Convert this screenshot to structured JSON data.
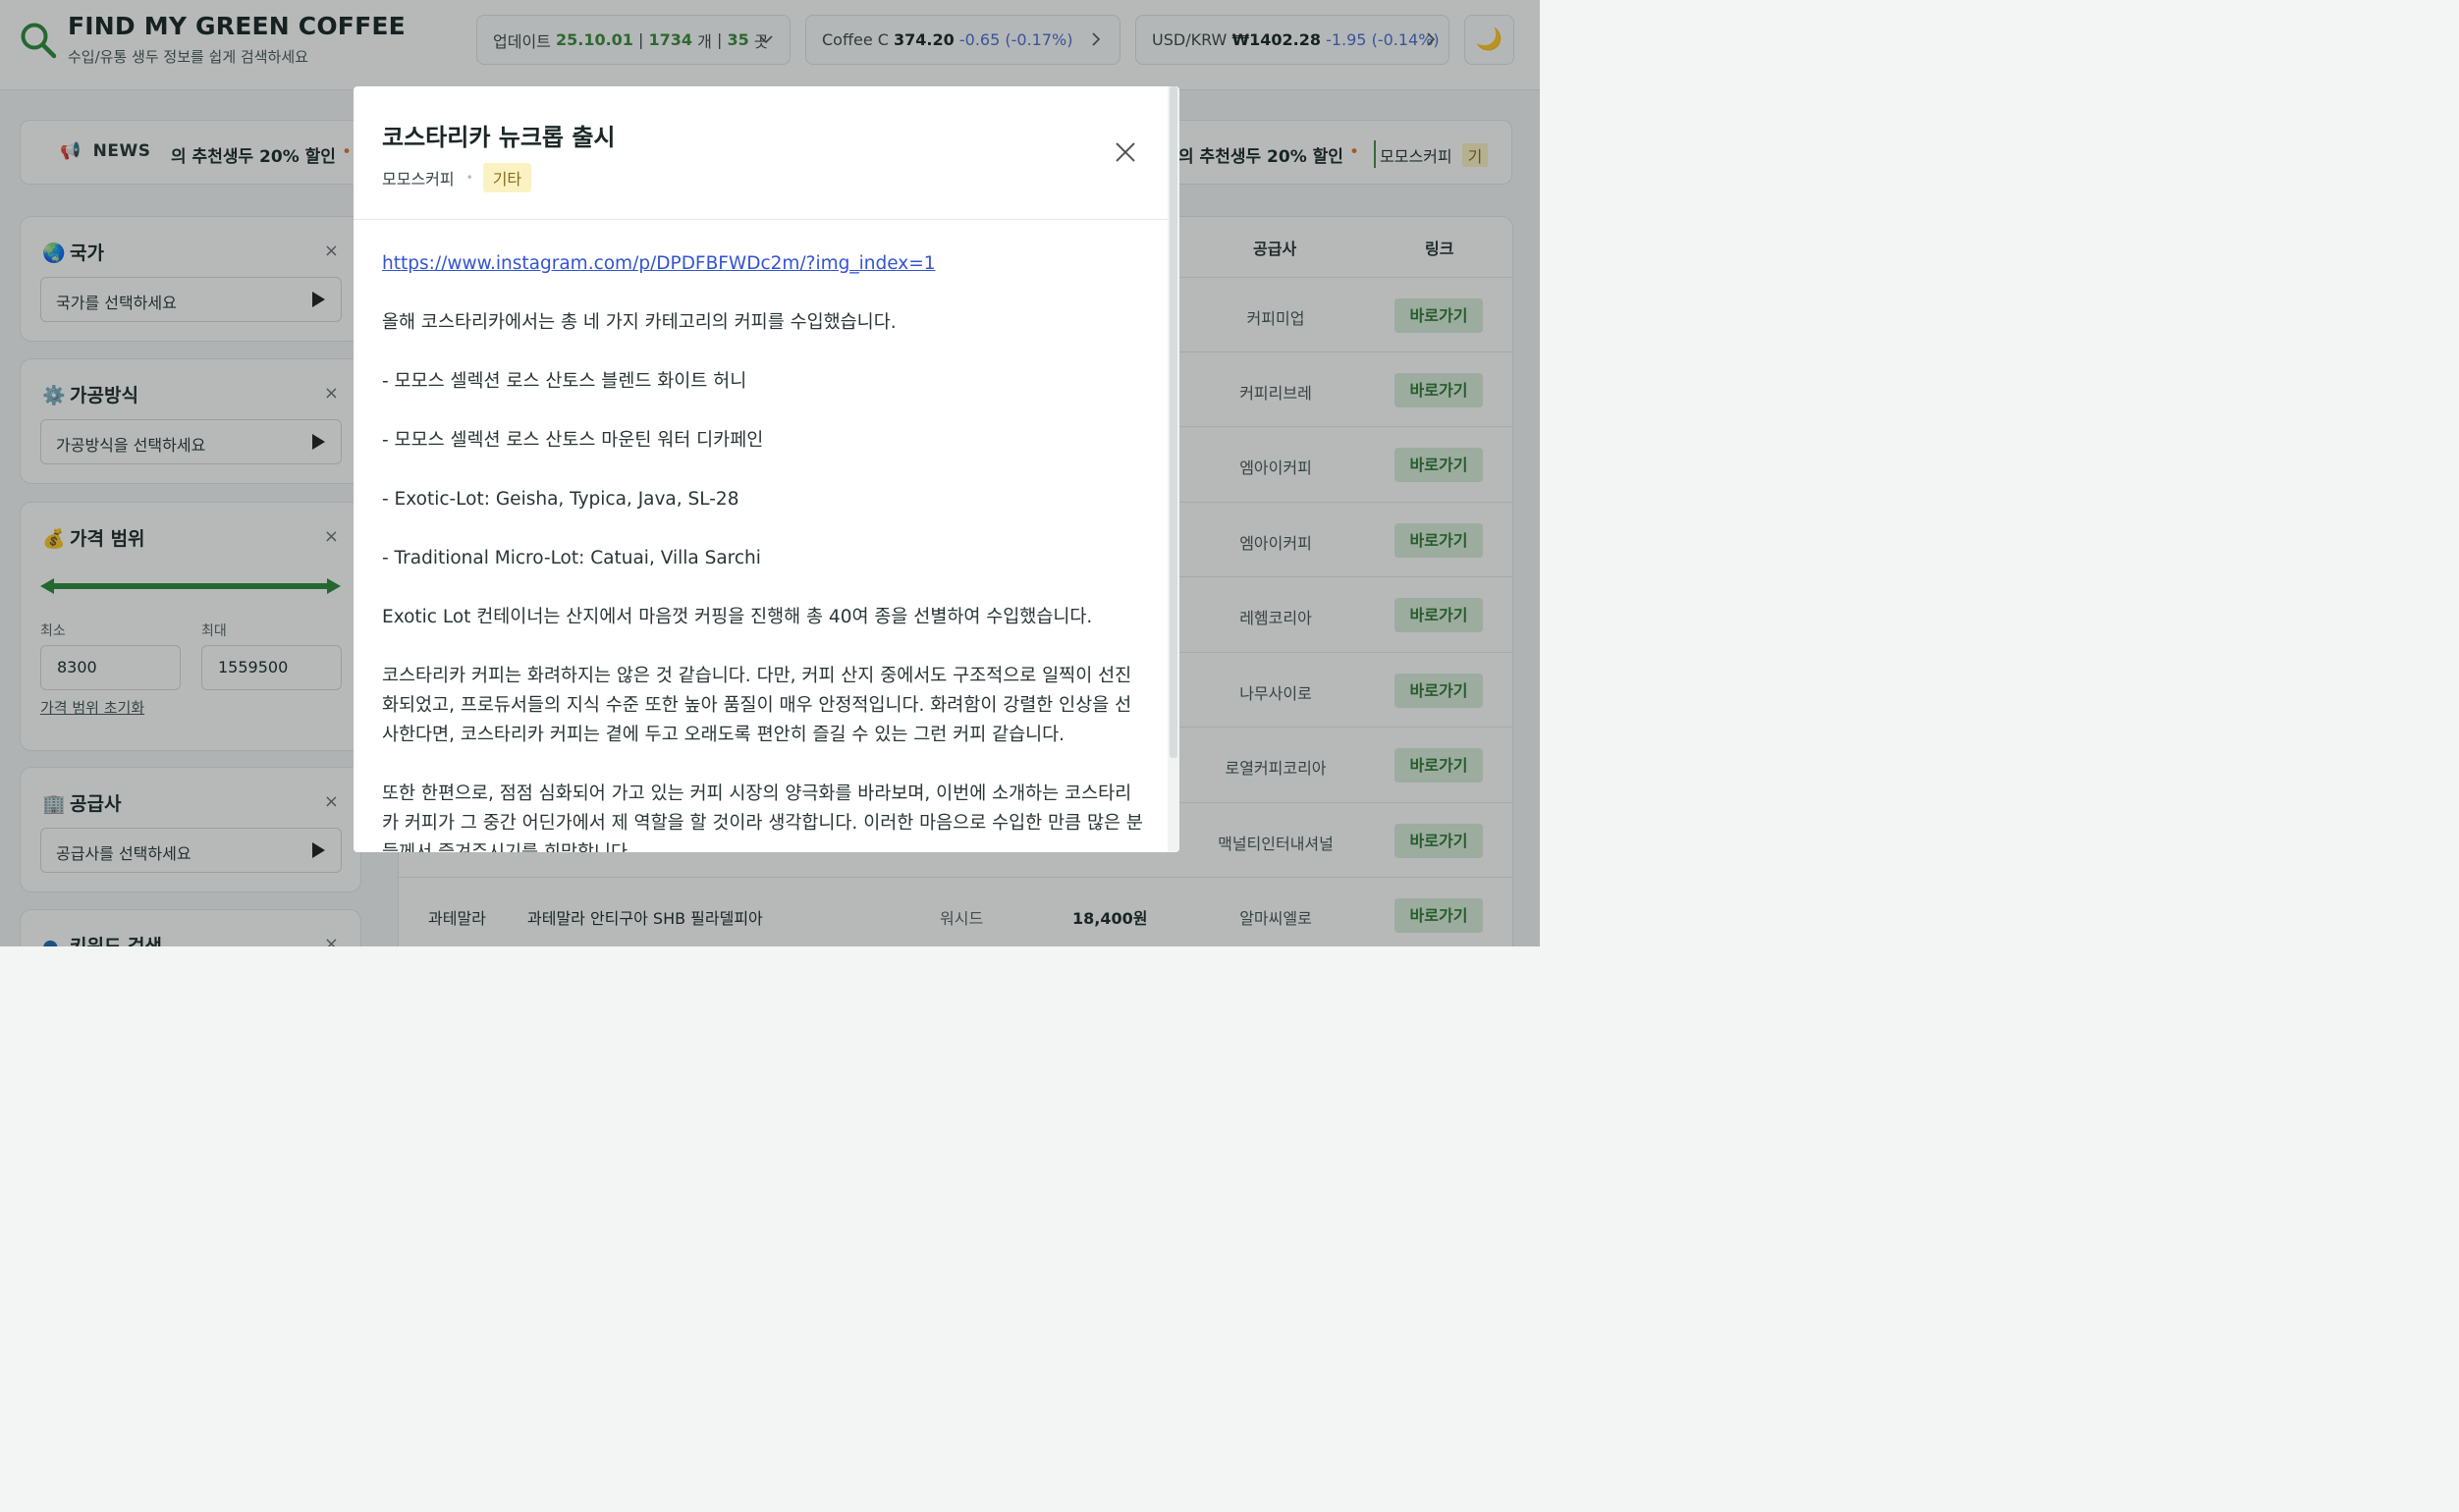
{
  "brand": {
    "title": "FIND MY GREEN COFFEE",
    "subtitle": "수입/유통 생두 정보를 쉽게 검색하세요"
  },
  "header": {
    "update": {
      "label": "업데이트",
      "date": "25.10.01",
      "sep1": "|",
      "count": "1734",
      "count_unit": "개",
      "sep2": "|",
      "suppliers": "35",
      "suppliers_unit": "곳"
    },
    "coffee_c": {
      "label": "Coffee C",
      "price": "374.20",
      "change": "-0.65",
      "pct": "(-0.17%)"
    },
    "usd_krw": {
      "label": "USD/KRW",
      "price": "₩1402.28",
      "change": "-1.95",
      "pct": "(-0.14%)"
    },
    "theme_toggle": "🌙"
  },
  "news": {
    "label": "NEWS",
    "items": [
      "의 추천생두 20% 할인",
      "의 추천생두 20% 할인"
    ],
    "chip": {
      "supplier": "모모스커피",
      "category": "기"
    }
  },
  "filters": {
    "country": {
      "title": "국가",
      "icon": "🌏",
      "placeholder": "국가를 선택하세요"
    },
    "process": {
      "title": "가공방식",
      "icon": "⚙️",
      "placeholder": "가공방식을 선택하세요"
    },
    "price": {
      "title": "가격 범위",
      "icon": "💰",
      "min_label": "최소",
      "max_label": "최대",
      "min": "8300",
      "max": "1559500",
      "reset": "가격 범위 초기화"
    },
    "supplier": {
      "title": "공급사",
      "icon": "🏢",
      "placeholder": "공급사를 선택하세요"
    },
    "keyword": {
      "title": "키워드 검색"
    },
    "clear": "×"
  },
  "table": {
    "headers": {
      "supplier": "공급사",
      "link": "링크"
    },
    "button_label": "바로가기",
    "rows": [
      {
        "supplier": "커피미업"
      },
      {
        "supplier": "커피리브레"
      },
      {
        "supplier": "엠아이커피"
      },
      {
        "supplier": "엠아이커피"
      },
      {
        "supplier": "레헴코리아"
      },
      {
        "supplier": "나무사이로"
      },
      {
        "supplier": "로열커피코리아"
      },
      {
        "supplier": "맥널티인터내셔널"
      },
      {
        "country": "과테말라",
        "name": "과테말라 안티구아 SHB 필라델피아",
        "process": "워시드",
        "price": "18,400원",
        "supplier": "알마씨엘로"
      }
    ]
  },
  "modal": {
    "title": "코스타리카 뉴크롭 출시",
    "supplier": "모모스커피",
    "separator": "•",
    "tag": "기타",
    "link": "https://www.instagram.com/p/DPDFBFWDc2m/?img_index=1",
    "paragraphs": [
      "올해 코스타리카에서는 총 네 가지 카테고리의 커피를 수입했습니다.",
      "- 모모스 셀렉션 로스 산토스 블렌드 화이트 허니",
      "- 모모스 셀렉션 로스 산토스 마운틴 워터 디카페인",
      "- Exotic-Lot: Geisha, Typica, Java, SL-28",
      "- Traditional Micro-Lot: Catuai, Villa Sarchi",
      "Exotic Lot 컨테이너는 산지에서 마음껏 커핑을 진행해 총 40여 종을 선별하여 수입했습니다.",
      "코스타리카 커피는 화려하지는 않은 것 같습니다. 다만, 커피 산지 중에서도 구조적으로 일찍이 선진화되었고, 프로듀서들의 지식 수준 또한 높아 품질이 매우 안정적입니다. 화려함이 강렬한 인상을 선사한다면, 코스타리카 커피는 곁에 두고 오래도록 편안히 즐길 수 있는 그런 커피 같습니다.",
      "또한 한편으로, 점점 심화되어 가고 있는 커피 시장의 양극화를 바라보며, 이번에 소개하는 코스타리카 커피가 그 중간 어딘가에서 제 역할을 할 것이라 생각합니다. 이러한 마음으로 수입한 만큼 많은 분들께서 즐겨주시기를 희망합니다."
    ]
  }
}
